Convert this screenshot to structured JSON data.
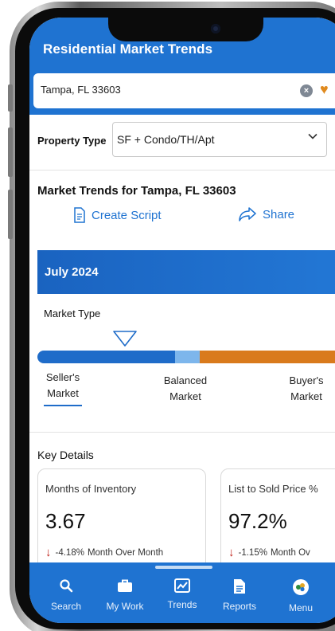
{
  "app": {
    "title": "Residential Market Trends"
  },
  "search": {
    "value": "Tampa, FL 33603"
  },
  "property_type": {
    "label": "Property Type",
    "selected": "SF + Condo/TH/Apt"
  },
  "trends": {
    "title": "Market Trends for Tampa, FL 33603",
    "create_script": "Create Script",
    "share": "Share"
  },
  "period": {
    "month": "July 2024"
  },
  "market_type": {
    "label": "Market Type",
    "sellers": [
      "Seller's",
      "Market"
    ],
    "balanced": [
      "Balanced",
      "Market"
    ],
    "buyers": [
      "Buyer's",
      "Market"
    ]
  },
  "key_details": {
    "title": "Key Details",
    "cards": [
      {
        "label": "Months of Inventory",
        "value": "3.67",
        "change": "-4.18%",
        "period": "Month Over Month"
      },
      {
        "label": "List to Sold Price %",
        "value": "97.2%",
        "change": "-1.15%",
        "period": "Month Ov"
      }
    ]
  },
  "nav": [
    {
      "label": "Search",
      "icon": "search-icon"
    },
    {
      "label": "My Work",
      "icon": "briefcase-icon"
    },
    {
      "label": "Trends",
      "icon": "trend-chart-icon"
    },
    {
      "label": "Reports",
      "icon": "document-icon"
    },
    {
      "label": "Menu",
      "icon": "menu-icon"
    }
  ],
  "colors": {
    "brand": "#1f73d1",
    "sellers": "#1f6cc9",
    "balanced": "#7db6ec",
    "buyers": "#d97a1c",
    "down": "#c0231b"
  }
}
